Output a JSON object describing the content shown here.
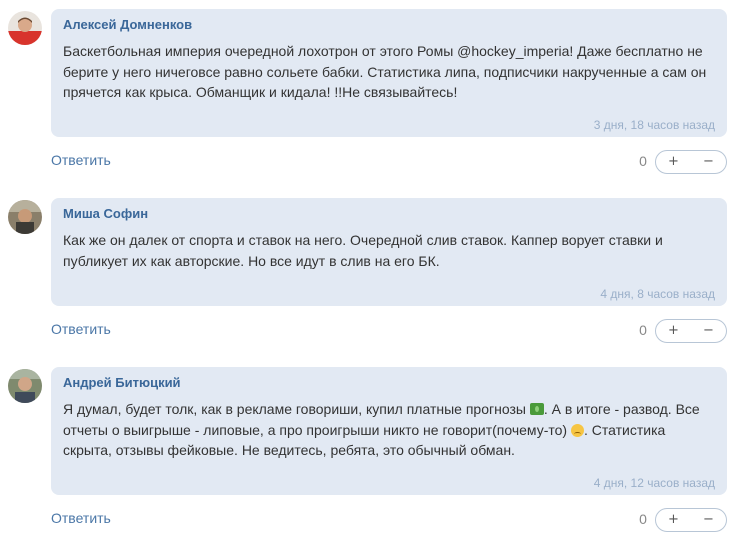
{
  "comments": [
    {
      "author": "Алексей Домненков",
      "text": "Баскетбольная империя очередной лохотрон от этого Ромы @hockey_imperia! Даже бесплатно не берите у него ничеговсе равно сольете бабки. Статистика липа, подписчики накрученные а сам он прячется как крыса. Обманщик и кидала! !!Не связывайтесь!",
      "time": "3 дня, 18 часов назад",
      "reply_label": "Ответить",
      "vote_count": "0",
      "plus_label": "+",
      "minus_label": "−"
    },
    {
      "author": "Миша Софин",
      "text": "Как же он далек от спорта и ставок на него. Очередной слив ставок. Каппер ворует ставки и публикует их как авторские. Но все идут в слив на его БК.",
      "time": "4 дня, 8 часов назад",
      "reply_label": "Ответить",
      "vote_count": "0",
      "plus_label": "+",
      "minus_label": "−"
    },
    {
      "author": "Андрей Битюцкий",
      "text_part1": "Я думал, будет толк, как в рекламе говориши, купил платные прогнозы",
      "text_part2": ". А в итоге - развод. Все отчеты о выигрыше - липовые, а про проигрыши никто не говорит(почему-то)",
      "text_part3": ". Статистика скрыта, отзывы фейковые. Не ведитесь, ребята, это обычный обман.",
      "emoji1": "money-emoji",
      "emoji2": "sad-face-emoji",
      "time": "4 дня, 12 часов назад",
      "reply_label": "Ответить",
      "vote_count": "0",
      "plus_label": "+",
      "minus_label": "−"
    }
  ]
}
